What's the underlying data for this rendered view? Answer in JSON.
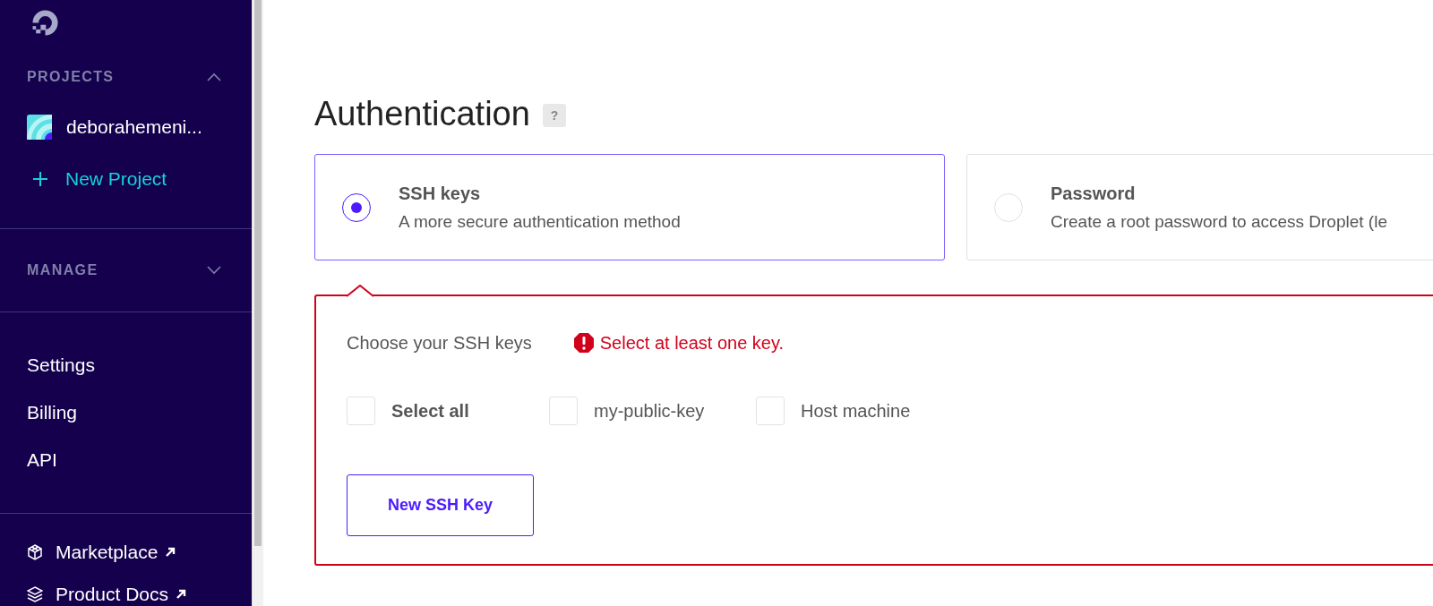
{
  "sidebar": {
    "sections": [
      {
        "title": "PROJECTS",
        "expanded": true,
        "items": [
          {
            "kind": "project",
            "label": "deborahemeni..."
          },
          {
            "kind": "new",
            "label": "New Project"
          }
        ]
      },
      {
        "title": "MANAGE",
        "expanded": false
      }
    ],
    "links": [
      "Settings",
      "Billing",
      "API"
    ],
    "external_links": [
      {
        "kind": "cube",
        "label": "Marketplace"
      },
      {
        "kind": "layers",
        "label": "Product Docs"
      }
    ]
  },
  "main": {
    "heading": "Authentication",
    "help": "?",
    "options": [
      {
        "title": "SSH keys",
        "description": "A more secure authentication method",
        "selected": true
      },
      {
        "title": "Password",
        "description": "Create a root password to access Droplet (le",
        "selected": false
      }
    ],
    "keys_panel": {
      "label": "Choose your SSH keys",
      "error": "Select at least one key.",
      "checkboxes": [
        {
          "kind": "all",
          "label": "Select all",
          "checked": false
        },
        {
          "kind": "key",
          "label": "my-public-key",
          "checked": false
        },
        {
          "kind": "key",
          "label": "Host machine",
          "checked": false
        }
      ],
      "button": "New SSH Key"
    }
  }
}
